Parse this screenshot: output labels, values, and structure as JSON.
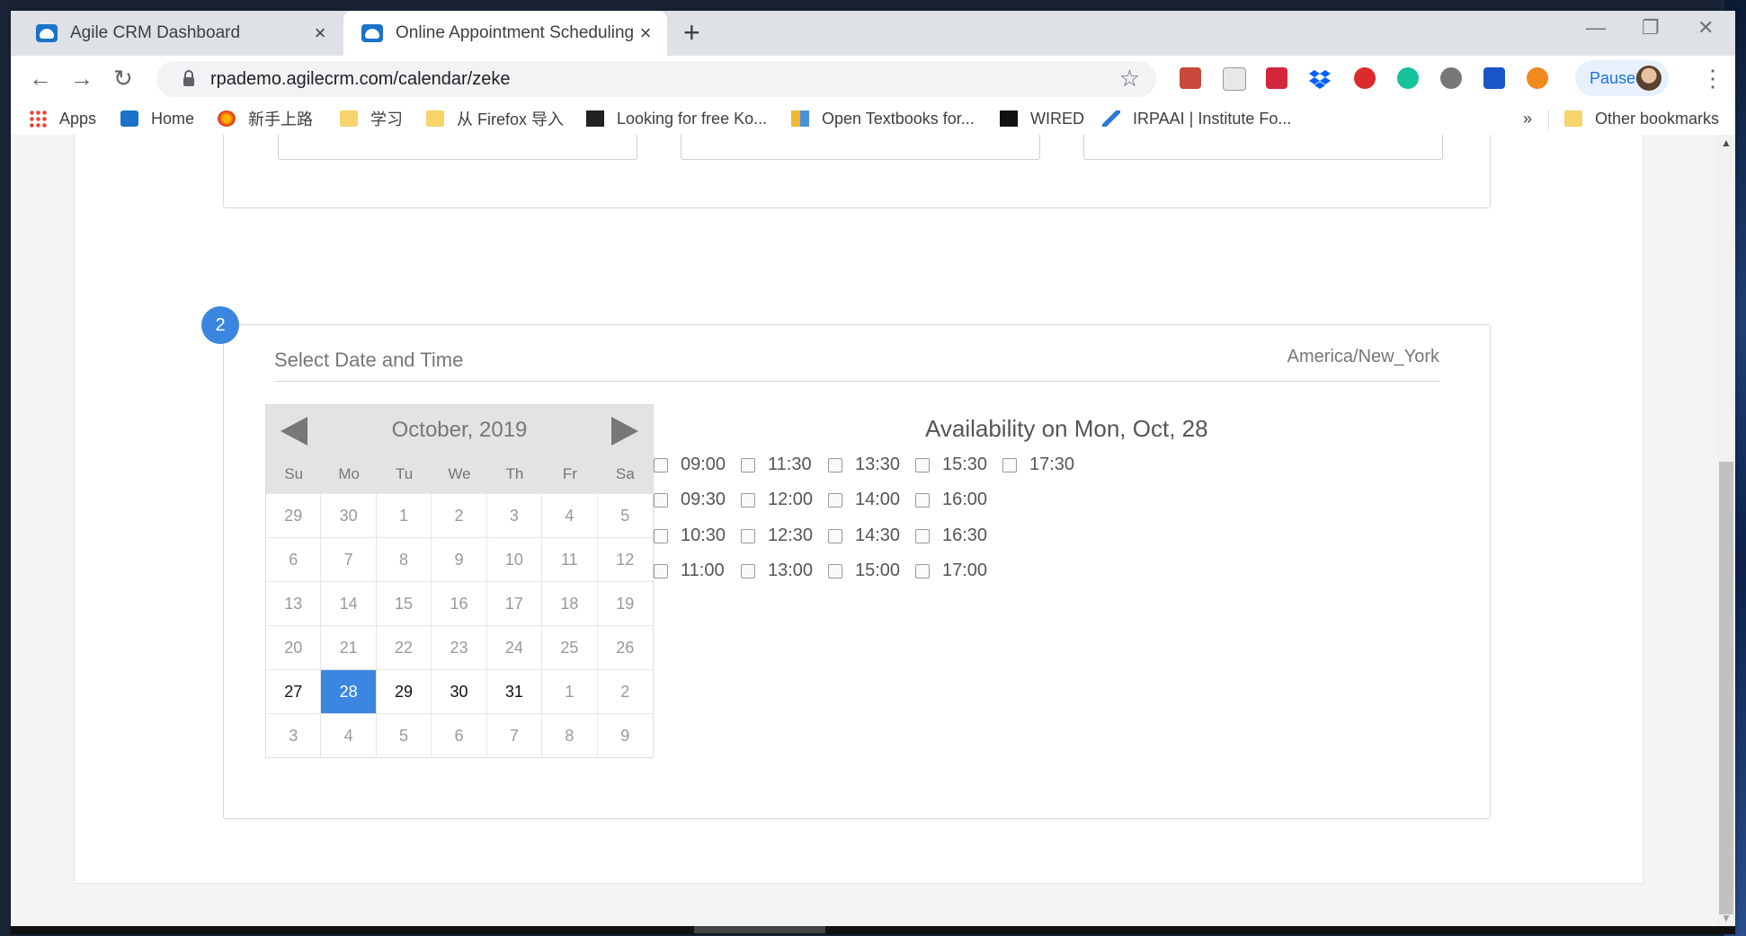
{
  "browser": {
    "tabs": [
      {
        "label": "Agile CRM Dashboard",
        "active": false
      },
      {
        "label": "Online Appointment Scheduling",
        "active": true
      }
    ],
    "url": "rpademo.agilecrm.com/calendar/zeke",
    "profile_status": "Paused",
    "bookmarks": [
      {
        "label": "Apps",
        "icon": "apps-grid-icon"
      },
      {
        "label": "Home",
        "icon": "cloud-icon"
      },
      {
        "label": "新手上路",
        "icon": "firefox-icon"
      },
      {
        "label": "学习",
        "icon": "folder-icon"
      },
      {
        "label": "从 Firefox 导入",
        "icon": "folder-icon"
      },
      {
        "label": "Looking for free Ko...",
        "icon": "e-icon"
      },
      {
        "label": "Open Textbooks for...",
        "icon": "book-icon"
      },
      {
        "label": "WIRED",
        "icon": "wired-icon"
      },
      {
        "label": "IRPAAI | Institute Fo...",
        "icon": "irpaai-icon"
      }
    ],
    "bookmarks_overflow": "»",
    "other_bookmarks": "Other bookmarks"
  },
  "scheduler": {
    "step_number": "2",
    "section_title": "Select Date and Time",
    "timezone": "America/New_York",
    "calendar": {
      "month_label": "October, 2019",
      "weekdays": [
        "Su",
        "Mo",
        "Tu",
        "We",
        "Th",
        "Fr",
        "Sa"
      ],
      "weeks": [
        [
          "29",
          "30",
          "1",
          "2",
          "3",
          "4",
          "5"
        ],
        [
          "6",
          "7",
          "8",
          "9",
          "10",
          "11",
          "12"
        ],
        [
          "13",
          "14",
          "15",
          "16",
          "17",
          "18",
          "19"
        ],
        [
          "20",
          "21",
          "22",
          "23",
          "24",
          "25",
          "26"
        ],
        [
          "27",
          "28",
          "29",
          "30",
          "31",
          "1",
          "2"
        ],
        [
          "3",
          "4",
          "5",
          "6",
          "7",
          "8",
          "9"
        ]
      ],
      "selected_day": "28",
      "available_days": [
        "27",
        "29",
        "30",
        "31"
      ]
    },
    "availability_title": "Availability on Mon, Oct, 28",
    "time_slots": [
      [
        "09:00",
        "09:30",
        "10:30",
        "11:00"
      ],
      [
        "11:30",
        "12:00",
        "12:30",
        "13:00"
      ],
      [
        "13:30",
        "14:00",
        "14:30",
        "15:00"
      ],
      [
        "15:30",
        "16:00",
        "16:30",
        "17:00"
      ],
      [
        "17:30"
      ]
    ]
  },
  "colors": {
    "accent": "#3b86e0",
    "selected_day_bg": "#3b86e0"
  }
}
